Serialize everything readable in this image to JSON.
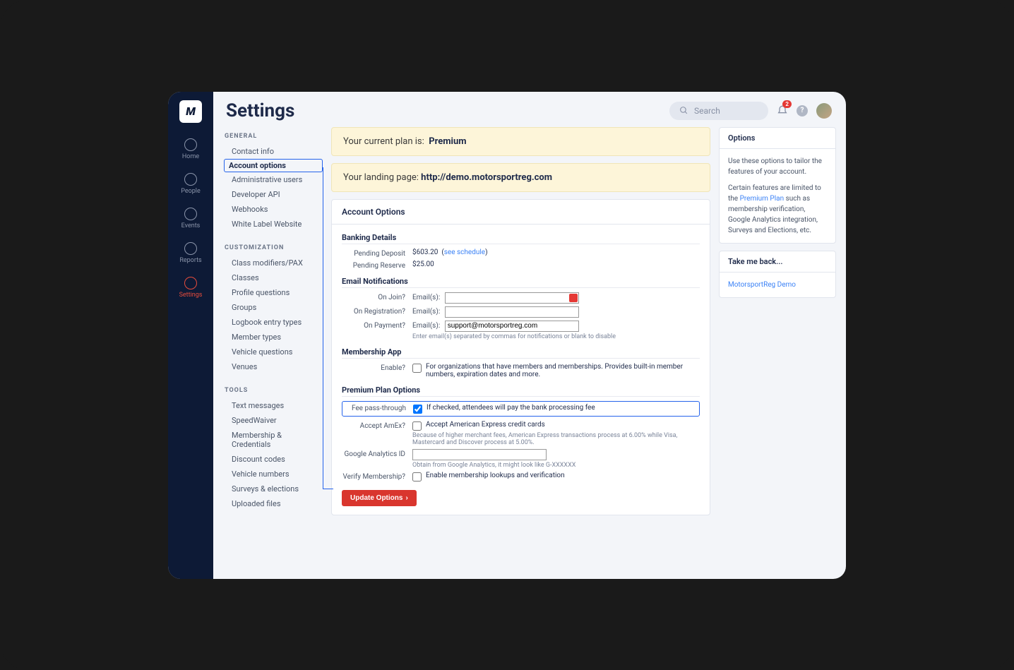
{
  "page_title": "Settings",
  "search_placeholder": "Search",
  "notification_count": "2",
  "rail": [
    {
      "label": "Home"
    },
    {
      "label": "People"
    },
    {
      "label": "Events"
    },
    {
      "label": "Reports"
    },
    {
      "label": "Settings"
    }
  ],
  "sidebar": {
    "sections": [
      {
        "heading": "GENERAL",
        "items": [
          "Contact info",
          "Account options",
          "Administrative users",
          "Developer API",
          "Webhooks",
          "White Label Website"
        ]
      },
      {
        "heading": "CUSTOMIZATION",
        "items": [
          "Class modifiers/PAX",
          "Classes",
          "Profile questions",
          "Groups",
          "Logbook entry types",
          "Member types",
          "Vehicle questions",
          "Venues"
        ]
      },
      {
        "heading": "TOOLS",
        "items": [
          "Text messages",
          "SpeedWaiver",
          "Membership & Credentials",
          "Discount codes",
          "Vehicle numbers",
          "Surveys & elections",
          "Uploaded files"
        ]
      }
    ]
  },
  "banner_plan_prefix": "Your current plan is:",
  "banner_plan_value": "Premium",
  "banner_landing_prefix": "Your landing page:",
  "banner_landing_url": "http://demo.motorsportreg.com",
  "panel_title": "Account Options",
  "sections": {
    "banking": {
      "heading": "Banking Details",
      "pending_deposit_label": "Pending Deposit",
      "pending_deposit_value": "$603.20",
      "see_schedule": "see schedule",
      "pending_reserve_label": "Pending Reserve",
      "pending_reserve_value": "$25.00"
    },
    "email": {
      "heading": "Email Notifications",
      "on_join_label": "On Join?",
      "on_reg_label": "On Registration?",
      "on_pay_label": "On Payment?",
      "field_prefix": "Email(s):",
      "on_join_value": "",
      "on_reg_value": "",
      "on_pay_value": "support@motorsportreg.com",
      "hint": "Enter email(s) separated by commas for notifications or blank to disable"
    },
    "membership": {
      "heading": "Membership App",
      "enable_label": "Enable?",
      "enable_desc": "For organizations that have members and memberships. Provides built-in member numbers, expiration dates and more."
    },
    "premium": {
      "heading": "Premium Plan Options",
      "fee_label": "Fee pass-through",
      "fee_desc": "If checked, attendees will pay the bank processing fee",
      "amex_label": "Accept AmEx?",
      "amex_desc": "Accept American Express credit cards",
      "amex_hint": "Because of higher merchant fees, American Express transactions process at 6.00% while Visa, Mastercard and Discover process at 5.00%.",
      "ga_label": "Google Analytics ID",
      "ga_value": "",
      "ga_hint": "Obtain from Google Analytics, it might look like G-XXXXXX",
      "verify_label": "Verify Membership?",
      "verify_desc": "Enable membership lookups and verification"
    }
  },
  "update_button": "Update Options",
  "right": {
    "options_title": "Options",
    "options_p1": "Use these options to tailor the features of your account.",
    "options_p2a": "Certain features are limited to the ",
    "options_p2_link": "Premium Plan",
    "options_p2b": " such as membership verification, Google Analytics integration, Surveys and Elections, etc.",
    "back_title": "Take me back...",
    "back_link": "MotorsportReg Demo"
  }
}
